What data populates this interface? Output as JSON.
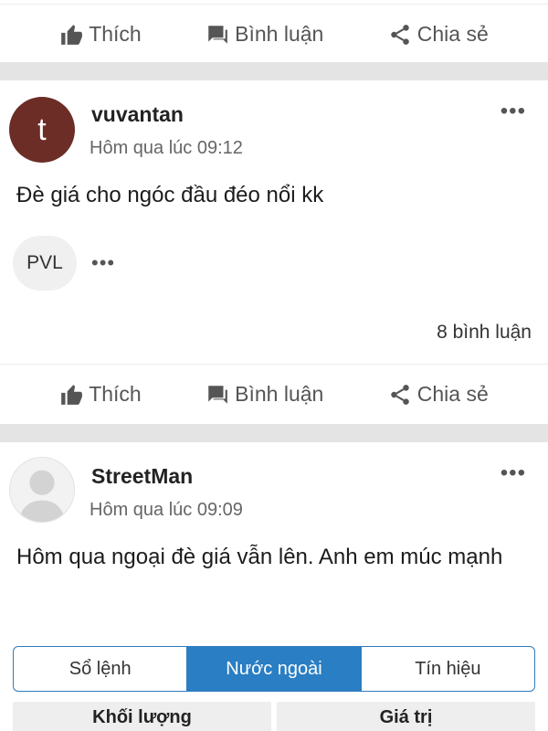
{
  "actions": {
    "like": "Thích",
    "comment": "Bình luận",
    "share": "Chia sẻ"
  },
  "posts": [
    {
      "avatar_letter": "t",
      "username": "vuvantan",
      "timestamp": "Hôm qua lúc 09:12",
      "content": "Đè giá cho ngóc đầu đéo nổi kk",
      "tag": "PVL",
      "comment_count": "8 bình luận"
    },
    {
      "username": "StreetMan",
      "timestamp": "Hôm qua lúc 09:09",
      "content": "Hôm qua ngoại đè giá vẫn lên. Anh em múc mạnh"
    }
  ],
  "tabs": [
    {
      "label": "Sổ lệnh",
      "active": false
    },
    {
      "label": "Nước ngoài",
      "active": true
    },
    {
      "label": "Tín hiệu",
      "active": false
    }
  ],
  "table_headers": [
    "Khối lượng",
    "Giá trị"
  ],
  "colors": {
    "accent": "#2a7ec3",
    "avatar": "#6b2d25",
    "separator": "#e4e4e4"
  }
}
